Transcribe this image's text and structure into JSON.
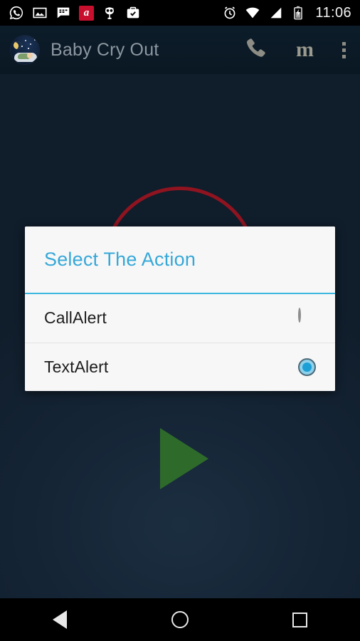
{
  "status_bar": {
    "time": "11:06",
    "left_icons": [
      {
        "name": "whatsapp-icon",
        "glyph": "whatsapp"
      },
      {
        "name": "gallery-icon",
        "glyph": "image"
      },
      {
        "name": "bbm-chat-icon",
        "glyph": "chat-bubble"
      },
      {
        "name": "avira-icon",
        "glyph": "a",
        "color": "#c8102e"
      },
      {
        "name": "owl-app-icon",
        "glyph": "owl"
      },
      {
        "name": "tasks-briefcase-icon",
        "glyph": "briefcase-check"
      }
    ],
    "right_icons": [
      {
        "name": "alarm-icon",
        "glyph": "alarm-clock"
      },
      {
        "name": "wifi-icon",
        "glyph": "wifi"
      },
      {
        "name": "cellular-signal-icon",
        "glyph": "signal-bars"
      },
      {
        "name": "battery-charging-icon",
        "glyph": "battery-bolt"
      }
    ]
  },
  "app_bar": {
    "title": "Baby Cry Out",
    "logo_name": "baby-cry-out-logo",
    "actions": [
      {
        "name": "call-action",
        "label": "phone-icon"
      },
      {
        "name": "m-action",
        "label": "m"
      },
      {
        "name": "overflow-action",
        "label": "more-options-icon"
      }
    ]
  },
  "content": {
    "record_ring_color": "#8f1420",
    "play_button_color": "#2e6b2a",
    "background_color": "#14273a"
  },
  "dialog": {
    "title": "Select The Action",
    "title_color": "#37a8d8",
    "divider_color": "#3fb8e0",
    "options": [
      {
        "label": "CallAlert",
        "selected": false
      },
      {
        "label": "TextAlert",
        "selected": true
      }
    ]
  },
  "nav_bar": {
    "buttons": [
      {
        "name": "nav-back-button",
        "label": "back"
      },
      {
        "name": "nav-home-button",
        "label": "home"
      },
      {
        "name": "nav-recents-button",
        "label": "recents"
      }
    ]
  }
}
